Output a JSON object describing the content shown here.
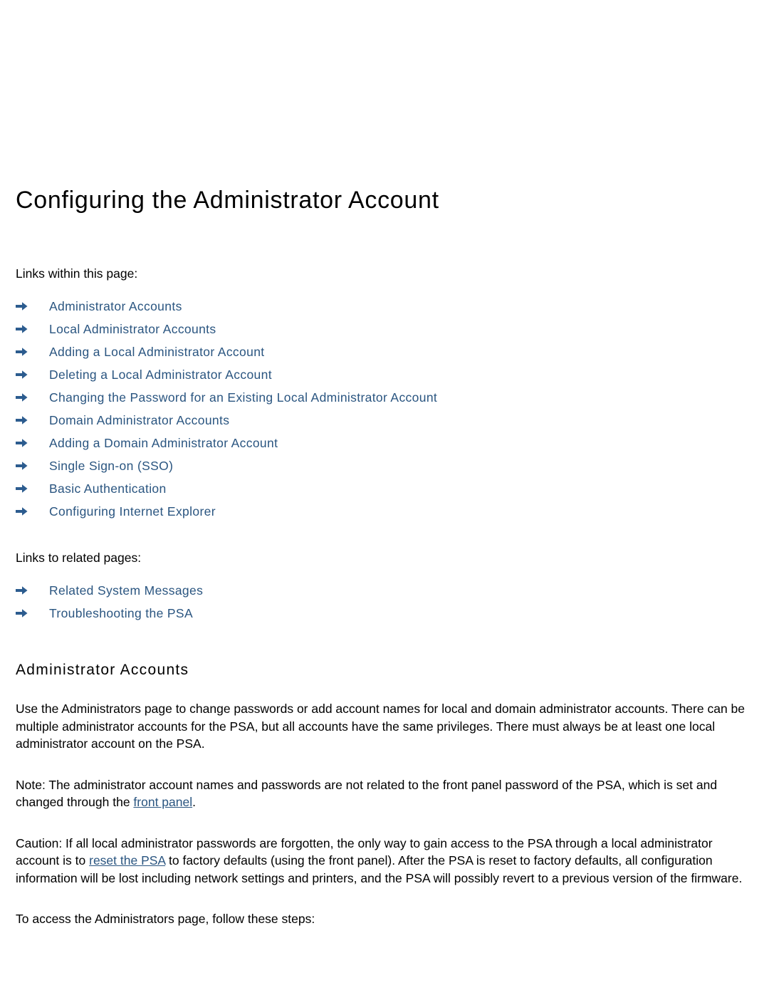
{
  "document": {
    "title": "Configuring the Administrator Account",
    "links_within_label": "Links within this page:",
    "links_related_label": "Links to related pages:",
    "links_within": [
      {
        "label": "Administrator Accounts"
      },
      {
        "label": "Local Administrator Accounts"
      },
      {
        "label": "Adding a Local Administrator Account"
      },
      {
        "label": "Deleting a Local Administrator Account"
      },
      {
        "label": "Changing the Password for an Existing Local Administrator Account"
      },
      {
        "label": "Domain Administrator Accounts"
      },
      {
        "label": "Adding a Domain Administrator Account"
      },
      {
        "label": "Single Sign-on (SSO)"
      },
      {
        "label": "Basic Authentication"
      },
      {
        "label": "Configuring Internet Explorer"
      }
    ],
    "links_related": [
      {
        "label": "Related System Messages"
      },
      {
        "label": "Troubleshooting the PSA"
      }
    ],
    "section": {
      "heading": "Administrator Accounts",
      "intro_paragraph": "Use the Administrators page to change passwords or add account names for local and domain administrator accounts. There can be multiple administrator accounts for the PSA, but all accounts have the same privileges. There must always be at least one local administrator account on the PSA.",
      "note": {
        "prefix": "Note: The administrator account names and passwords are not related to the front panel password of the PSA, which is set and changed through the ",
        "link": "front panel",
        "suffix": "."
      },
      "caution": {
        "prefix": "Caution: If all local administrator passwords are forgotten, the only way to gain access to the PSA through a local administrator account is to ",
        "link": "reset the PSA",
        "suffix": " to factory defaults (using the front panel). After the PSA is reset to factory defaults, all configuration information will be lost including network settings and printers, and the PSA will possibly revert to a previous version of the firmware."
      },
      "closing_paragraph": "To access the Administrators page, follow these steps:"
    },
    "colors": {
      "link": "#2a5580",
      "arrow": "#2c5c8f",
      "text": "#000000",
      "background": "#ffffff"
    }
  }
}
